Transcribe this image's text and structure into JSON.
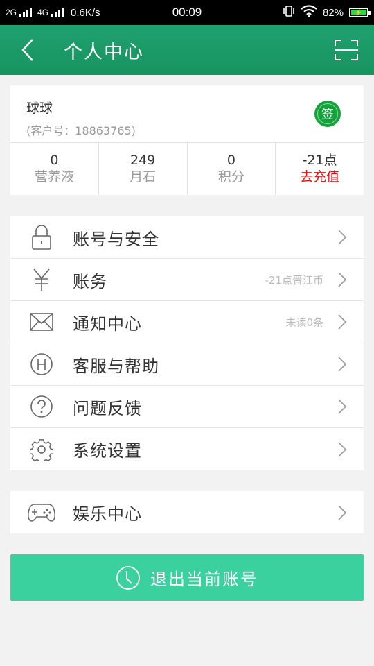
{
  "status_bar": {
    "net1": "2G",
    "net2": "4G",
    "speed": "0.6K/s",
    "time": "00:09",
    "battery": "82%"
  },
  "header": {
    "title": "个人中心",
    "back_icon": "chevron-left-icon",
    "scan_icon": "scan-icon"
  },
  "profile": {
    "username": "球球",
    "customer_no": "(客户号：18863765)",
    "sign_label": "签",
    "stats": [
      {
        "value": "0",
        "label": "营养液"
      },
      {
        "value": "249",
        "label": "月石"
      },
      {
        "value": "0",
        "label": "积分"
      },
      {
        "value": "-21点",
        "label": "去充值"
      }
    ]
  },
  "menu": {
    "items": [
      {
        "label": "账号与安全",
        "extra": "",
        "icon": "lock-icon"
      },
      {
        "label": "账务",
        "extra": "-21点晋江币",
        "icon": "yen-icon"
      },
      {
        "label": "通知中心",
        "extra": "未读0条",
        "icon": "mail-icon"
      },
      {
        "label": "客服与帮助",
        "extra": "",
        "icon": "help-h-icon"
      },
      {
        "label": "问题反馈",
        "extra": "",
        "icon": "question-icon"
      },
      {
        "label": "系统设置",
        "extra": "",
        "icon": "gear-icon"
      }
    ]
  },
  "entertainment": {
    "label": "娱乐中心",
    "icon": "gamepad-icon"
  },
  "logout": {
    "label": "退出当前账号",
    "icon": "clock-icon"
  },
  "colors": {
    "header_green": "#1fa170",
    "logout_green": "#3bd19e",
    "recharge_red": "#e60f0f",
    "sign_green": "#14a33a"
  }
}
